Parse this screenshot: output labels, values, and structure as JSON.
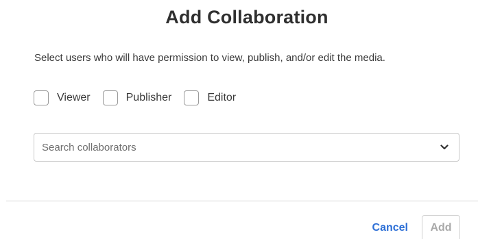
{
  "dialog": {
    "title": "Add Collaboration",
    "description": "Select users who will have permission to view, publish, and/or edit the media."
  },
  "roles": [
    {
      "label": "Viewer",
      "checked": false
    },
    {
      "label": "Publisher",
      "checked": false
    },
    {
      "label": "Editor",
      "checked": false
    }
  ],
  "search": {
    "placeholder": "Search collaborators",
    "icon": "chevron-down-icon"
  },
  "footer": {
    "cancel_label": "Cancel",
    "add_label": "Add",
    "add_disabled": true
  },
  "colors": {
    "accent": "#2d6fd6",
    "disabled_text": "#a9a9a9",
    "border": "#c8c8c8"
  }
}
